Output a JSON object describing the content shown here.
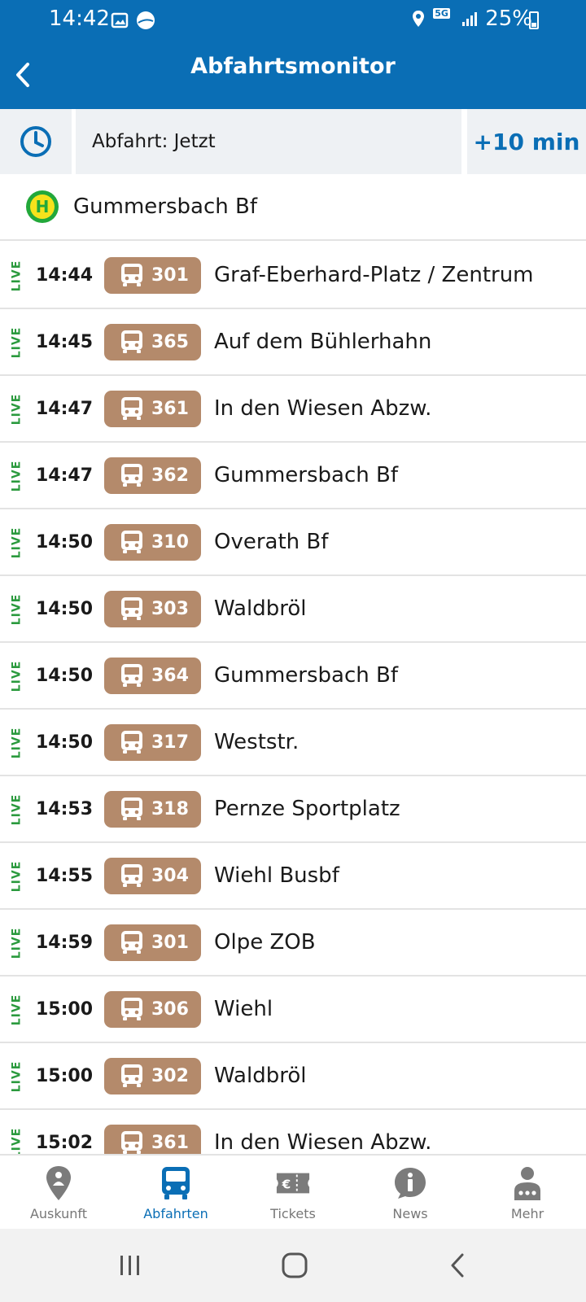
{
  "status_bar": {
    "time": "14:42",
    "battery": "25%",
    "network": "5G"
  },
  "header": {
    "title": "Abfahrtsmonitor"
  },
  "time_bar": {
    "departure_label": "Abfahrt: Jetzt",
    "plus_button": "+10 min"
  },
  "station": {
    "name": "Gummersbach Bf",
    "icon": "bus-stop-h-icon"
  },
  "colors": {
    "header": "#0a6eb5",
    "line_badge": "#b48a6b",
    "live": "#2b9a3e",
    "active_tab": "#0a6eb5"
  },
  "departures": [
    {
      "live": "LIVE",
      "time": "14:44",
      "line": "301",
      "destination": "Graf-Eberhard-Platz / Zentrum"
    },
    {
      "live": "LIVE",
      "time": "14:45",
      "line": "365",
      "destination": "Auf dem Bühlerhahn"
    },
    {
      "live": "LIVE",
      "time": "14:47",
      "line": "361",
      "destination": "In den Wiesen Abzw."
    },
    {
      "live": "LIVE",
      "time": "14:47",
      "line": "362",
      "destination": "Gummersbach Bf"
    },
    {
      "live": "LIVE",
      "time": "14:50",
      "line": "310",
      "destination": "Overath Bf"
    },
    {
      "live": "LIVE",
      "time": "14:50",
      "line": "303",
      "destination": "Waldbröl"
    },
    {
      "live": "LIVE",
      "time": "14:50",
      "line": "364",
      "destination": "Gummersbach Bf"
    },
    {
      "live": "LIVE",
      "time": "14:50",
      "line": "317",
      "destination": "Weststr."
    },
    {
      "live": "LIVE",
      "time": "14:53",
      "line": "318",
      "destination": "Pernze Sportplatz"
    },
    {
      "live": "LIVE",
      "time": "14:55",
      "line": "304",
      "destination": "Wiehl Busbf"
    },
    {
      "live": "LIVE",
      "time": "14:59",
      "line": "301",
      "destination": "Olpe ZOB"
    },
    {
      "live": "LIVE",
      "time": "15:00",
      "line": "306",
      "destination": "Wiehl"
    },
    {
      "live": "LIVE",
      "time": "15:00",
      "line": "302",
      "destination": "Waldbröl"
    },
    {
      "live": "LIVE",
      "time": "15:02",
      "line": "361",
      "destination": "In den Wiesen Abzw."
    }
  ],
  "tabs": [
    {
      "label": "Auskunft",
      "icon": "location-pin-icon"
    },
    {
      "label": "Abfahrten",
      "icon": "bus-icon"
    },
    {
      "label": "Tickets",
      "icon": "ticket-icon"
    },
    {
      "label": "News",
      "icon": "info-icon"
    },
    {
      "label": "Mehr",
      "icon": "person-more-icon"
    }
  ]
}
